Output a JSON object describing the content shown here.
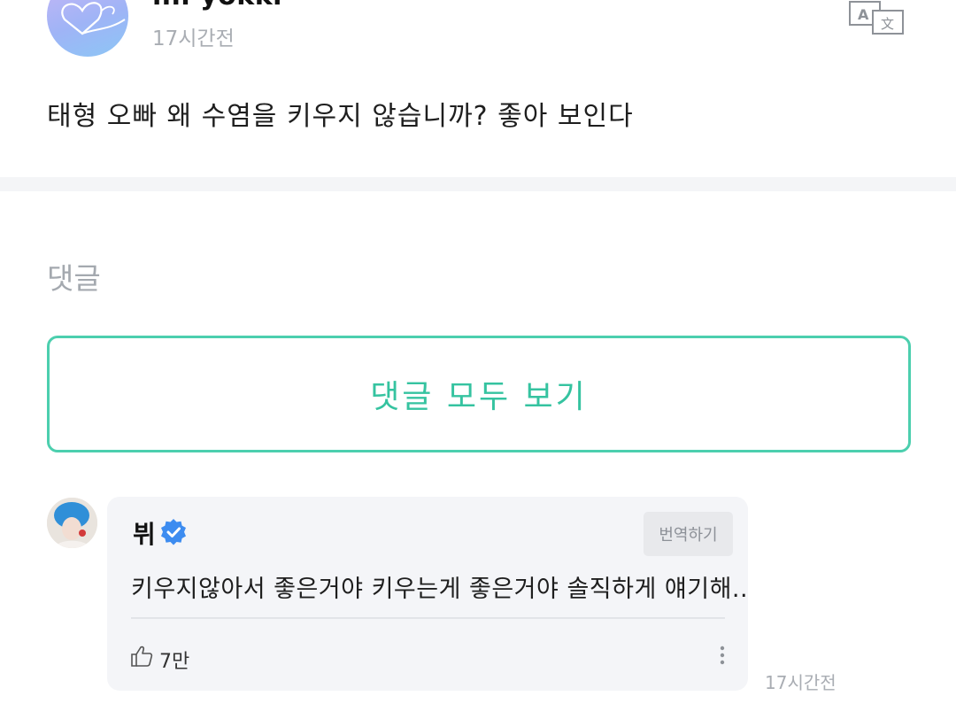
{
  "post": {
    "author": "iiii yokki",
    "time": "17시간전",
    "body": "태형 오빠 왜 수염을 키우지 않습니까?  좋아 보인다",
    "avatar_icon": "heart-scribble-icon",
    "translate_icon": "translate-icon"
  },
  "comments": {
    "heading": "댓글",
    "view_all_label": "댓글 모두 보기"
  },
  "comment": {
    "author": "뷔",
    "verified_icon": "verified-badge-icon",
    "translate_label": "번역하기",
    "text": "키우지않아서 좋은거야 키우는게 좋은거야 솔직하게 얘기해..",
    "likes": "7만",
    "time": "17시간전"
  },
  "colors": {
    "accent": "#35c3a0",
    "verified": "#3d8cf0",
    "card_bg": "#f4f5f8"
  }
}
